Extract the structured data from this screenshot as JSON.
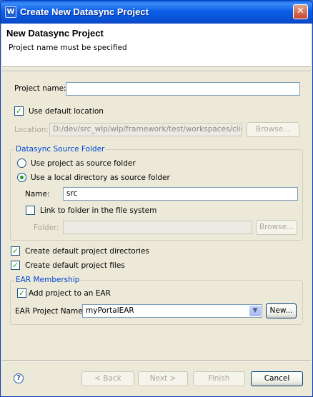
{
  "window": {
    "title": "Create New Datasync Project"
  },
  "header": {
    "title": "New Datasync Project",
    "message": "Project name must be specified"
  },
  "project": {
    "name_label": "Project name:",
    "name_value": "",
    "use_default_location_label": "Use default location",
    "use_default_location_checked": true,
    "location_label": "Location:",
    "location_value": "D:/dev/src_wlp/wlp/framework/test/workspaces/client",
    "browse_label": "Browse..."
  },
  "source_folder": {
    "group_title": "Datasync Source Folder",
    "option_project_label": "Use project as source folder",
    "option_local_label": "Use a local directory as source folder",
    "selected": "local",
    "name_label": "Name:",
    "name_value": "src",
    "link_label": "Link to folder in the file system",
    "link_checked": false,
    "folder_label": "Folder:",
    "folder_value": "",
    "browse_label": "Browse..."
  },
  "options": {
    "create_dirs_label": "Create default project directories",
    "create_dirs_checked": true,
    "create_files_label": "Create default project files",
    "create_files_checked": true
  },
  "ear": {
    "group_title": "EAR Membership",
    "add_label": "Add project to an EAR",
    "add_checked": true,
    "project_label": "EAR Project Name",
    "project_value": "myPortalEAR",
    "new_label": "New..."
  },
  "footer": {
    "back_label": "< Back",
    "next_label": "Next >",
    "finish_label": "Finish",
    "cancel_label": "Cancel",
    "help_symbol": "?"
  },
  "icons": {
    "checkmark": "✓",
    "close": "✕",
    "dropdown": "▼",
    "app": "W"
  }
}
